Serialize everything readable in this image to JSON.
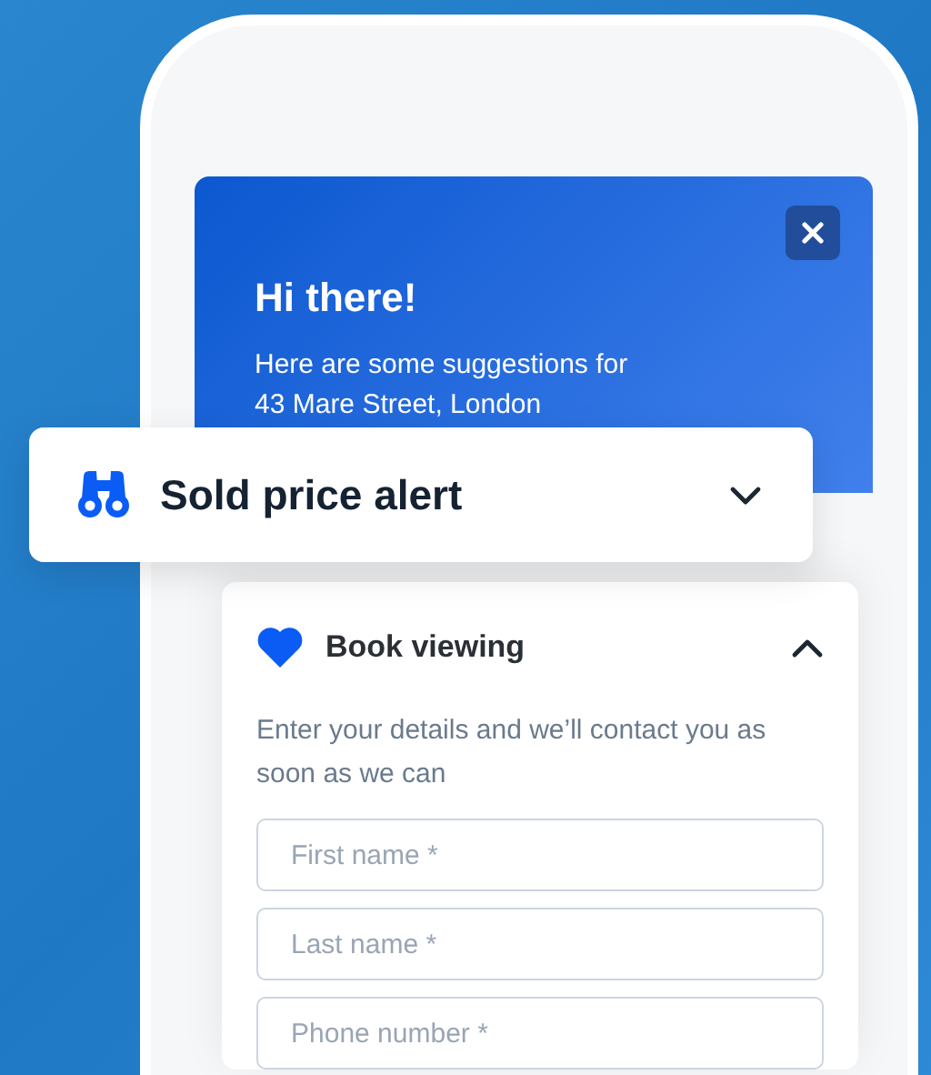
{
  "header": {
    "title": "Hi there!",
    "subtitle_lines": [
      "Here are some suggestions for",
      "43 Mare Street, London"
    ]
  },
  "alert_card": {
    "title": "Sold price alert",
    "expanded": false
  },
  "booking_card": {
    "title": "Book viewing",
    "expanded": true,
    "description": "Enter your details and we’ll contact you as soon as we can",
    "fields": [
      {
        "placeholder": "First name *"
      },
      {
        "placeholder": "Last name *"
      },
      {
        "placeholder": "Phone number *"
      }
    ]
  }
}
